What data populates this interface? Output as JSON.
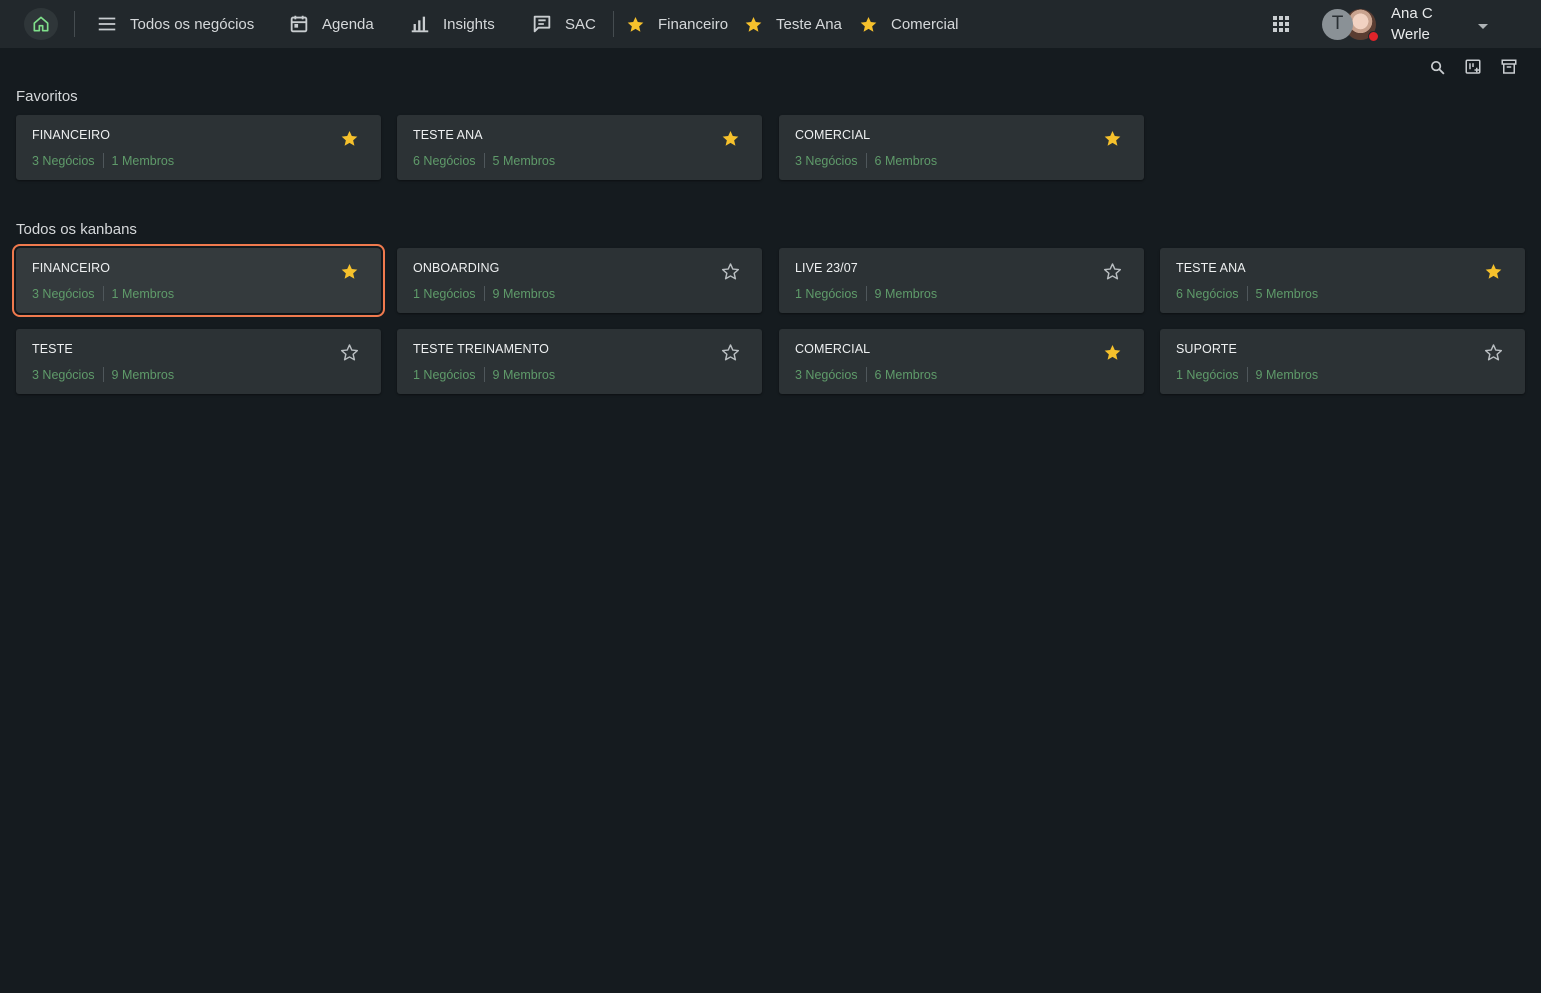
{
  "topbar": {
    "home_icon": "home-icon",
    "nav": [
      {
        "label": "Todos os negócios",
        "icon": "menu-icon"
      },
      {
        "label": "Agenda",
        "icon": "calendar-icon"
      },
      {
        "label": "Insights",
        "icon": "bar-chart-icon"
      },
      {
        "label": "SAC",
        "icon": "chat-icon"
      }
    ],
    "favorites": [
      {
        "label": "Financeiro",
        "icon": "star-icon"
      },
      {
        "label": "Teste Ana",
        "icon": "star-icon"
      },
      {
        "label": "Comercial",
        "icon": "star-icon"
      }
    ],
    "user": {
      "avatar_letter": "T",
      "name_line1": "Ana C",
      "name_line2": "Werle",
      "status_color": "#e0242a"
    }
  },
  "toolbar": {
    "search_icon": "search-icon",
    "add_kanban_icon": "add-kanban-icon",
    "archive_icon": "archive-icon"
  },
  "favoritos": {
    "title": "Favoritos",
    "cards": [
      {
        "name": "FINANCEIRO",
        "negocios": "3 Negócios",
        "membros": "1 Membros",
        "favorite": true
      },
      {
        "name": "TESTE ANA",
        "negocios": "6 Negócios",
        "membros": "5 Membros",
        "favorite": true
      },
      {
        "name": "COMERCIAL",
        "negocios": "3 Negócios",
        "membros": "6 Membros",
        "favorite": true
      }
    ]
  },
  "todos": {
    "title": "Todos os kanbans",
    "cards": [
      {
        "name": "FINANCEIRO",
        "negocios": "3 Negócios",
        "membros": "1 Membros",
        "favorite": true
      },
      {
        "name": "ONBOARDING",
        "negocios": "1 Negócios",
        "membros": "9 Membros",
        "favorite": false
      },
      {
        "name": "LIVE 23/07",
        "negocios": "1 Negócios",
        "membros": "9 Membros",
        "favorite": false
      },
      {
        "name": "TESTE ANA",
        "negocios": "6 Negócios",
        "membros": "5 Membros",
        "favorite": true
      },
      {
        "name": "TESTE",
        "negocios": "3 Negócios",
        "membros": "9 Membros",
        "favorite": false
      },
      {
        "name": "TESTE TREINAMENTO",
        "negocios": "1 Negócios",
        "membros": "9 Membros",
        "favorite": false
      },
      {
        "name": "COMERCIAL",
        "negocios": "3 Negócios",
        "membros": "6 Membros",
        "favorite": true
      },
      {
        "name": "SUPORTE",
        "negocios": "1 Negócios",
        "membros": "9 Membros",
        "favorite": false
      }
    ]
  },
  "colors": {
    "accent_star": "#f6c12c",
    "meta_green": "#5f9b6a",
    "selected_outline": "#f07a4e",
    "home_icon": "#7fe08a"
  }
}
